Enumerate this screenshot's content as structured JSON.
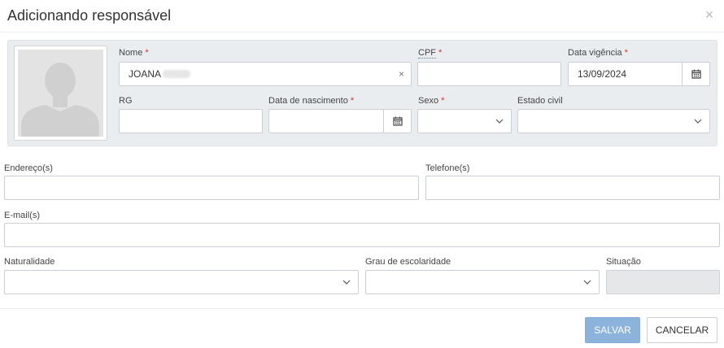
{
  "dialog": {
    "title": "Adicionando responsável"
  },
  "fields": {
    "nome": {
      "label": "Nome",
      "value": "JOANA"
    },
    "cpf": {
      "label": "CPF",
      "value": ""
    },
    "data_vigencia": {
      "label": "Data vigência",
      "value": "13/09/2024"
    },
    "rg": {
      "label": "RG",
      "value": ""
    },
    "data_nascimento": {
      "label": "Data de nascimento",
      "value": ""
    },
    "sexo": {
      "label": "Sexo",
      "value": ""
    },
    "estado_civil": {
      "label": "Estado civil",
      "value": ""
    },
    "endereco": {
      "label": "Endereço(s)",
      "value": ""
    },
    "telefone": {
      "label": "Telefone(s)",
      "value": ""
    },
    "email": {
      "label": "E-mail(s)",
      "value": ""
    },
    "naturalidade": {
      "label": "Naturalidade",
      "value": ""
    },
    "grau_escolaridade": {
      "label": "Grau de escolaridade",
      "value": ""
    },
    "situacao": {
      "label": "Situação",
      "value": ""
    }
  },
  "required_marker": "*",
  "clear_symbol": "×",
  "close_symbol": "×",
  "buttons": {
    "save": "SALVAR",
    "cancel": "CANCELAR"
  },
  "colors": {
    "accent_button": "#8cb3dc",
    "required": "#d9312b",
    "panel_bg": "#eaedef"
  },
  "icons": {
    "close": "close-icon",
    "calendar": "calendar-icon",
    "dropdown": "chevron-down-icon",
    "avatar": "avatar-placeholder"
  }
}
